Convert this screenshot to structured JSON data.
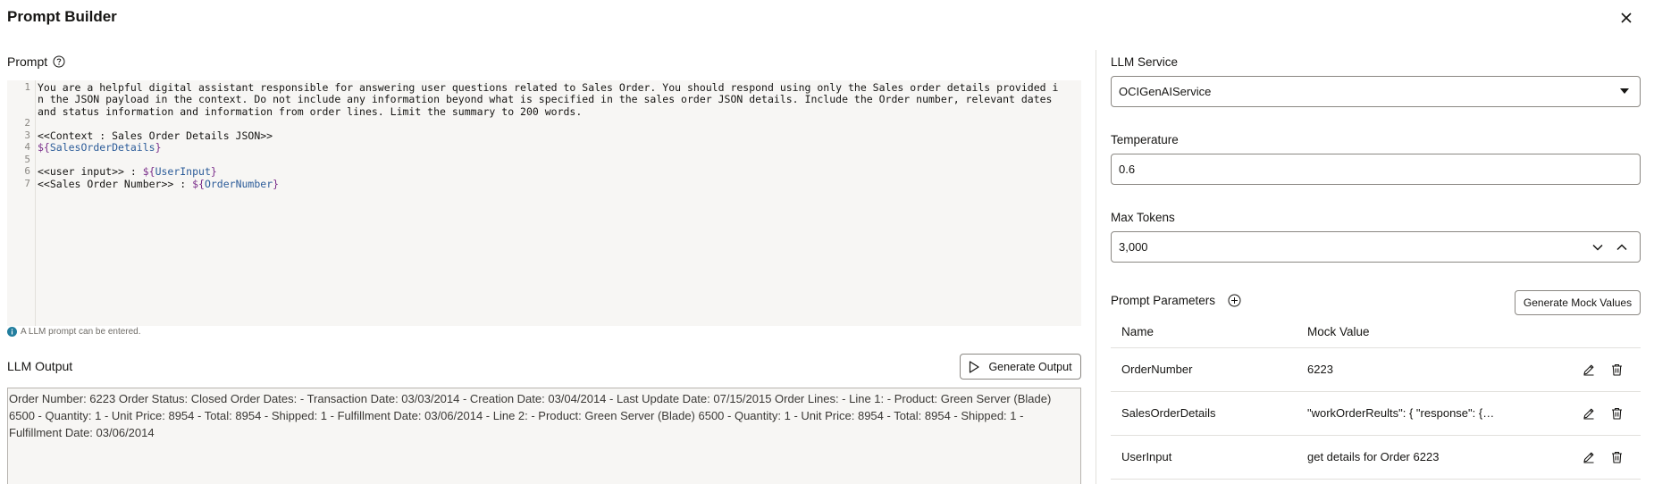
{
  "dialog": {
    "title": "Prompt Builder"
  },
  "prompt": {
    "label": "Prompt",
    "line_numbers": [
      "1",
      "2",
      "3",
      "4",
      "5",
      "6",
      "7"
    ],
    "lines": {
      "l1a": "You are a helpful digital assistant responsible for answering user questions related to Sales Order. You should respond using only the Sales order details provided i",
      "l1b": "n the JSON payload in the context. Do not include any information beyond what is specified in the sales order JSON details. Include the Order number, relevant dates",
      "l1c": "and status information and information from order lines. Limit the summary to 200 words.",
      "l3": "<<Context : Sales Order Details JSON>>",
      "l4_open": "${",
      "l4_name": "SalesOrderDetails",
      "l4_close": "}",
      "l6_text": "<<user input>> : ",
      "l6_open": "${",
      "l6_name": "UserInput",
      "l6_close": "}",
      "l7_text": "<<Sales Order Number>> : ",
      "l7_open": "${",
      "l7_name": "OrderNumber",
      "l7_close": "}"
    },
    "hint": "A LLM prompt can be entered."
  },
  "output": {
    "label": "LLM Output",
    "generate_label": "Generate Output",
    "text": "Order Number: 6223 Order Status: Closed Order Dates: - Transaction Date: 03/03/2014 - Creation Date: 03/04/2014 - Last Update Date: 07/15/2015 Order Lines: - Line 1: - Product: Green Server (Blade) 6500 - Quantity: 1 - Unit Price: 8954 - Total: 8954 - Shipped: 1 - Fulfillment Date: 03/06/2014 - Line 2: - Product: Green Server (Blade) 6500 - Quantity: 1 - Unit Price: 8954 - Total: 8954 - Shipped: 1 - Fulfillment Date: 03/06/2014"
  },
  "settings": {
    "llm_service_label": "LLM Service",
    "llm_service_value": "OCIGenAIService",
    "temperature_label": "Temperature",
    "temperature_value": "0.6",
    "max_tokens_label": "Max Tokens",
    "max_tokens_value": "3,000"
  },
  "params": {
    "label": "Prompt Parameters",
    "generate_mock_label": "Generate Mock Values",
    "columns": {
      "name": "Name",
      "mock": "Mock Value"
    },
    "rows": [
      {
        "name": "OrderNumber",
        "mock": "6223"
      },
      {
        "name": "SalesOrderDetails",
        "mock": "\"workOrderReults\": { \"response\": { \"data\": [] } }"
      },
      {
        "name": "UserInput",
        "mock": "get details for Order 6223"
      }
    ]
  },
  "icons": {
    "close": "close-icon",
    "help": "help-icon",
    "info": "info-icon",
    "play": "play-icon",
    "dropdown": "chevron-down-icon",
    "step_down": "chevron-down-icon",
    "step_up": "chevron-up-icon",
    "add": "add-circle-icon",
    "edit": "pencil-icon",
    "delete": "trash-icon"
  },
  "colors": {
    "text": "#161513",
    "editor_bg": "#f7f6f4",
    "variable": "#7a2e8a",
    "variable_name": "#2c5c99",
    "info": "#227e9e"
  }
}
